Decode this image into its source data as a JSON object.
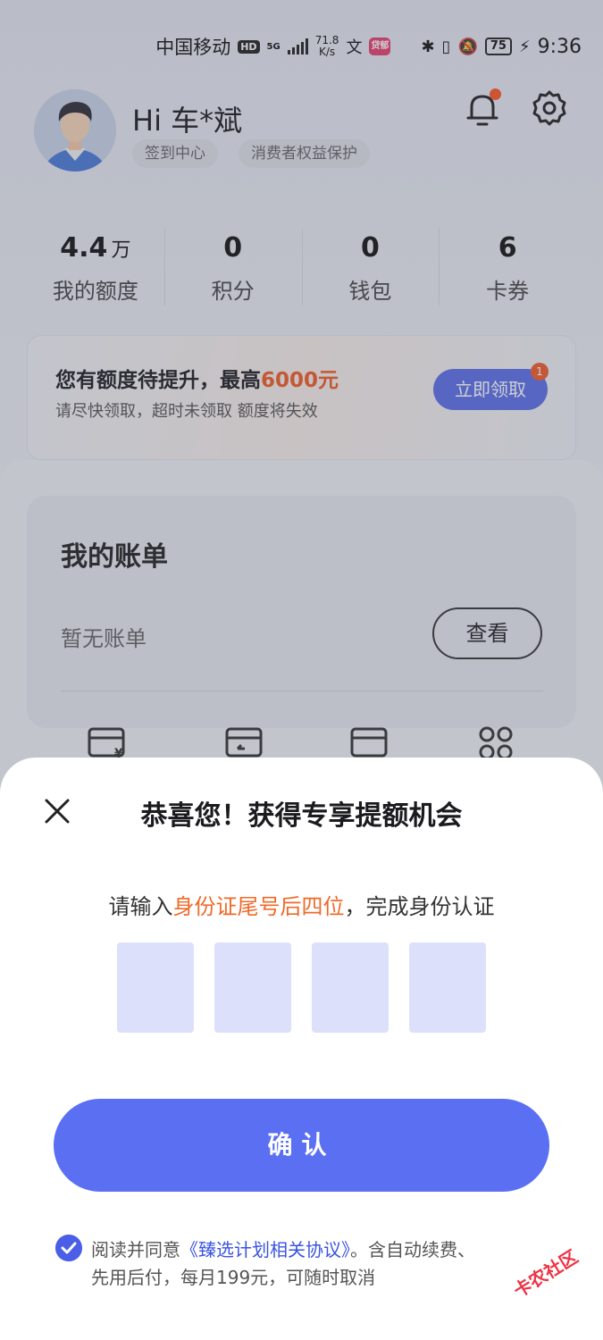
{
  "status_bar": {
    "carrier": "中国移动",
    "hd": "HD",
    "net": "5G",
    "speed_value": "71.8",
    "speed_unit": "K/s",
    "app_badge": "贷郁",
    "battery": "75",
    "time": "9:36"
  },
  "profile": {
    "greeting": "Hi 车*斌",
    "chip_checkin": "签到中心",
    "chip_protection": "消费者权益保护"
  },
  "stats": [
    {
      "value": "4.4",
      "unit": "万",
      "label": "我的额度"
    },
    {
      "value": "0",
      "unit": "",
      "label": "积分"
    },
    {
      "value": "0",
      "unit": "",
      "label": "钱包"
    },
    {
      "value": "6",
      "unit": "",
      "label": "卡券"
    }
  ],
  "promo": {
    "title_prefix": "您有额度待提升，最高",
    "title_amount": "6000元",
    "subtitle": "请尽快领取，超时未领取 额度将失效",
    "button": "立即领取",
    "badge": "1"
  },
  "bill": {
    "title": "我的账单",
    "empty_text": "暂无账单",
    "view_button": "查看"
  },
  "sheet": {
    "title": "恭喜您！获得专享提额机会",
    "prompt_prefix": "请输入",
    "prompt_highlight": "身份证尾号后四位",
    "prompt_suffix": "，完成身份认证",
    "confirm": "确认",
    "agree_prefix": "阅读并同意",
    "agree_link": "《臻选计划相关协议》",
    "agree_suffix": "。含自动续费、",
    "agree_line2": "先用后付，每月199元，可随时取消"
  },
  "watermark": "卡农社区",
  "colors": {
    "accent_orange": "#f15a22",
    "primary_blue": "#5a6ff2",
    "code_box": "#dde0fb"
  }
}
